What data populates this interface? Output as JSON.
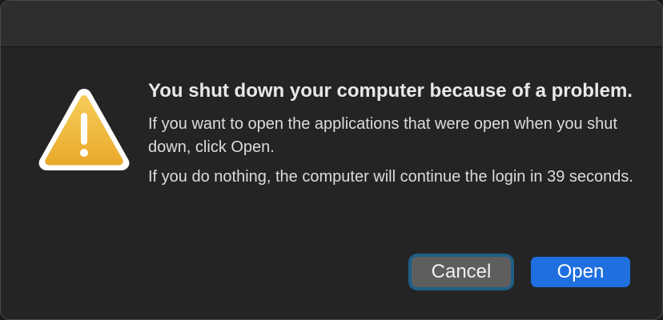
{
  "dialog": {
    "headline": "You shut down your computer because of a problem.",
    "message_1": "If you want to open the applications that were open when you shut down, click Open.",
    "message_2": "If you do nothing, the computer will continue the login in 39 seconds.",
    "icon": "warning-icon",
    "cancel_label": "Cancel",
    "open_label": "Open"
  },
  "colors": {
    "accent": "#1f6fe0",
    "focus_ring": "#1f5f86",
    "warning": "#f2b73a"
  }
}
